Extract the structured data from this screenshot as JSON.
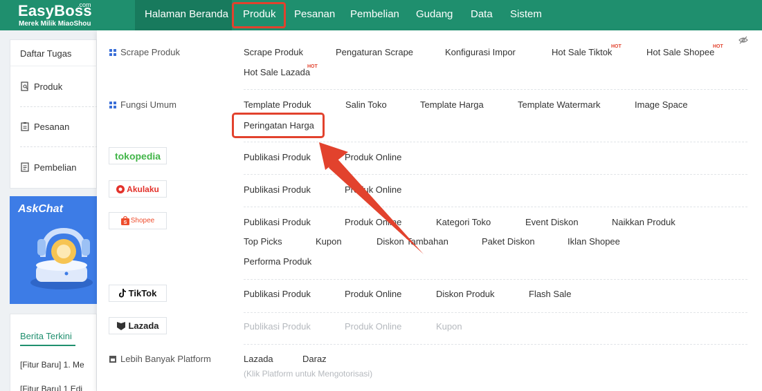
{
  "brand": {
    "name": "EasyBoss",
    "suffix": ".com",
    "tagline": "Merek Milik MiaoShou"
  },
  "nav": {
    "home": "Halaman Beranda",
    "items": [
      "Produk",
      "Pesanan",
      "Pembelian",
      "Gudang",
      "Data",
      "Sistem"
    ]
  },
  "sidebar": {
    "tasks_title": "Daftar Tugas",
    "tasks": [
      "Produk",
      "Pesanan",
      "Pembelian"
    ],
    "banner_title": "AskChat",
    "news_tab": "Berita Terkini",
    "news": [
      "[Fitur Baru] 1. Me",
      "[Fitur Baru] 1 Edi"
    ]
  },
  "menu": {
    "scrape": {
      "label": "Scrape Produk",
      "links": [
        "Scrape Produk",
        "Pengaturan Scrape",
        "Konfigurasi Impor",
        "Hot Sale Tiktok",
        "Hot Sale Shopee",
        "Hot Sale Lazada"
      ],
      "hot_badge": "HOT"
    },
    "general": {
      "label": "Fungsi Umum",
      "links": [
        "Template Produk",
        "Salin Toko",
        "Template Harga",
        "Template Watermark",
        "Image Space",
        "Peringatan Harga"
      ]
    },
    "tokopedia": {
      "logo": "tokopedia",
      "links": [
        "Publikasi Produk",
        "Produk Online"
      ]
    },
    "akulaku": {
      "logo": "Akulaku",
      "links": [
        "Publikasi Produk",
        "Produk Online"
      ]
    },
    "shopee": {
      "logo": "Shopee",
      "links": [
        "Publikasi Produk",
        "Produk Online",
        "Kategori Toko",
        "Event Diskon",
        "Naikkan Produk",
        "Top Picks",
        "Kupon",
        "Diskon Tambahan",
        "Paket Diskon",
        "Iklan Shopee",
        "Performa Produk"
      ]
    },
    "tiktok": {
      "logo": "TikTok",
      "links": [
        "Publikasi Produk",
        "Produk Online",
        "Diskon Produk",
        "Flash Sale"
      ]
    },
    "lazada": {
      "logo": "Lazada",
      "links": [
        "Publikasi Produk",
        "Produk Online",
        "Kupon"
      ]
    },
    "more": {
      "label": "Lebih Banyak Platform",
      "links": [
        "Lazada",
        "Daraz"
      ],
      "hint": "(Klik Platform untuk Mengotorisasi)"
    }
  },
  "colors": {
    "brand_green": "#1f8f6e",
    "highlight_red": "#e2422d",
    "disabled_text": "#b5b9be"
  }
}
